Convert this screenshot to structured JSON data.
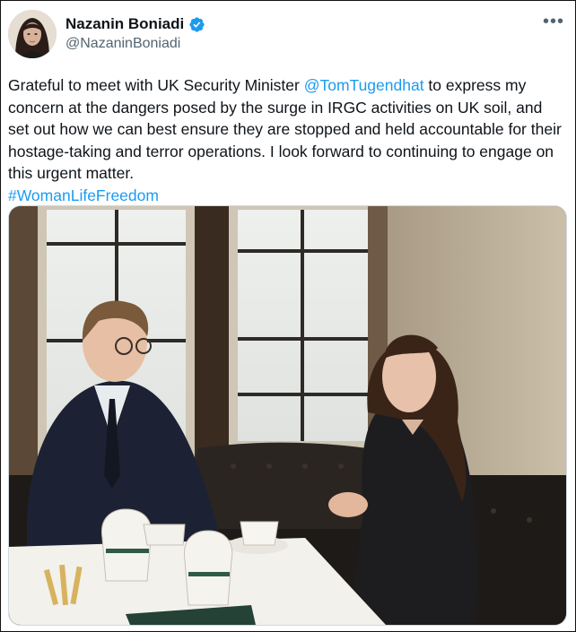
{
  "author": {
    "name": "Nazanin Boniadi",
    "handle": "@NazaninBoniadi",
    "verified": true
  },
  "tweet": {
    "text_before": "Grateful to meet with UK Security Minister ",
    "mention": "@TomTugendhat",
    "text_after": " to express my concern at the dangers posed by the surge in IRGC activities on UK soil, and set out how we can best ensure they are stopped and held accountable for their hostage-taking and terror operations. I look forward to continuing to engage on this urgent matter.",
    "hashtag": "#WomanLifeFreedom"
  },
  "icons": {
    "verified": "verified-badge-icon",
    "more": "more-options-icon"
  },
  "colors": {
    "link": "#1d9bf0",
    "verified": "#1d9bf0",
    "text": "#0f1419",
    "secondary": "#536471"
  }
}
